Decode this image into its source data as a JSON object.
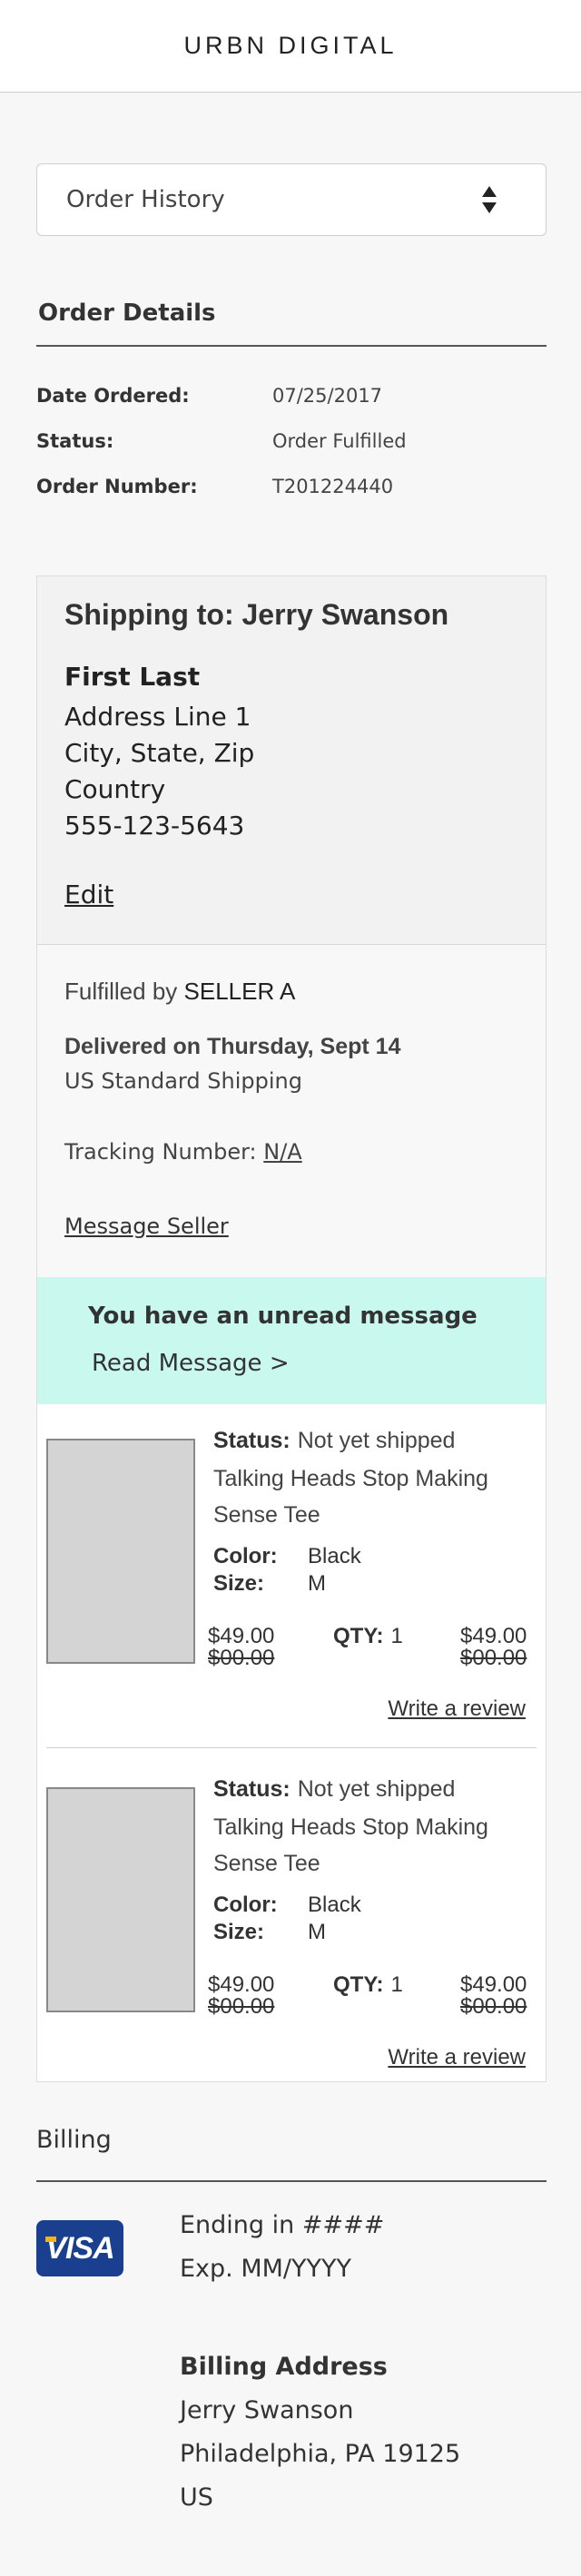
{
  "header": {
    "brand": "URBN DIGITAL"
  },
  "dropdown": {
    "selected": "Order History",
    "icon": "sort-arrows-icon"
  },
  "order_details": {
    "title": "Order Details",
    "rows": [
      {
        "label": "Date Ordered:",
        "value": "07/25/2017"
      },
      {
        "label": "Status:",
        "value": "Order Fulfilled"
      },
      {
        "label": "Order Number:",
        "value": "T201224440"
      }
    ]
  },
  "shipping": {
    "title": "Shipping to: Jerry Swanson",
    "name": "First Last",
    "address_lines": [
      "Address Line 1",
      "City, State, Zip",
      "Country",
      "555-123-5643"
    ],
    "edit_label": "Edit"
  },
  "fulfillment": {
    "label": "Fulfilled by",
    "seller": "SELLER A",
    "delivered": "Delivered on Thursday, Sept 14",
    "method": "US Standard Shipping",
    "tracking_label": "Tracking Number:",
    "tracking_value": "N/A",
    "message_seller": "Message Seller"
  },
  "unread": {
    "title": "You have an unread message",
    "link": "Read Message >",
    "background": "#c8f8ee"
  },
  "items": [
    {
      "status_label": "Status:",
      "status_value": "Not yet shipped",
      "name": "Talking Heads Stop Making Sense Tee",
      "color_label": "Color:",
      "color_value": "Black",
      "size_label": "Size:",
      "size_value": "M",
      "price": "$49.00",
      "price_strike": "$00.00",
      "qty_label": "QTY:",
      "qty_value": "1",
      "total": "$49.00",
      "total_strike": "$00.00",
      "review_label": "Write a review"
    },
    {
      "status_label": "Status:",
      "status_value": "Not yet shipped",
      "name": "Talking Heads Stop Making Sense Tee",
      "color_label": "Color:",
      "color_value": "Black",
      "size_label": "Size:",
      "size_value": "M",
      "price": "$49.00",
      "price_strike": "$00.00",
      "qty_label": "QTY:",
      "qty_value": "1",
      "total": "$49.00",
      "total_strike": "$00.00",
      "review_label": "Write a review"
    }
  ],
  "billing": {
    "title": "Billing",
    "card_brand": "VISA",
    "ending": "Ending in ####",
    "expiry": "Exp. MM/YYYY",
    "address_title": "Billing Address",
    "address_lines": [
      "Jerry Swanson",
      "Philadelphia, PA 19125",
      "US"
    ]
  }
}
